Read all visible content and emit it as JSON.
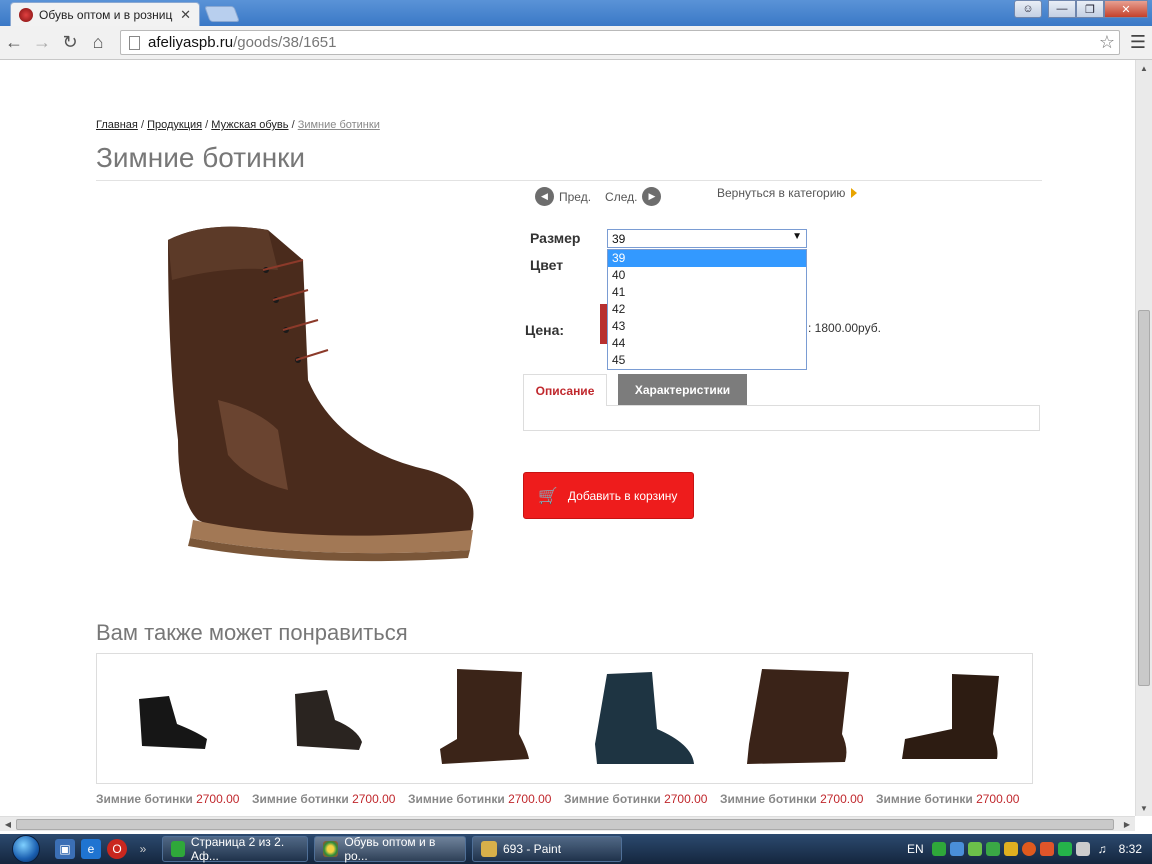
{
  "browser": {
    "tab_title": "Обувь оптом и в розниц",
    "tab_close": "✕",
    "url_host": "afeliyaspb.ru",
    "url_path": "/goods/38/1651"
  },
  "breadcrumb": {
    "home": "Главная",
    "sep": "/",
    "products": "Продукция",
    "mens": "Мужская обувь",
    "current": "Зимние ботинки"
  },
  "product": {
    "title": "Зимние ботинки",
    "prev_label": "Пред.",
    "next_label": "След.",
    "back_label": "Вернуться в категорию",
    "size_label": "Размер",
    "color_label": "Цвет",
    "price_label": "Цена:",
    "price_text": ": 1800.00руб.",
    "selected_size": "39",
    "size_options": [
      "39",
      "40",
      "41",
      "42",
      "43",
      "44",
      "45"
    ],
    "tab_description": "Описание",
    "tab_characteristics": "Характеристики",
    "cart_button": "Добавить в корзину"
  },
  "also": {
    "title": "Вам также может понравиться",
    "items": [
      {
        "name": "Зимние ботинки",
        "price": "2700.00"
      },
      {
        "name": "Зимние ботинки",
        "price": "2700.00"
      },
      {
        "name": "Зимние ботинки",
        "price": "2700.00"
      },
      {
        "name": "Зимние ботинки",
        "price": "2700.00"
      },
      {
        "name": "Зимние ботинки",
        "price": "2700.00"
      },
      {
        "name": "Зимние ботинки",
        "price": "2700.00"
      }
    ]
  },
  "taskbar": {
    "tasks": [
      {
        "label": "Страница 2 из 2. Аф..."
      },
      {
        "label": "Обувь оптом и в ро..."
      },
      {
        "label": "693 - Paint"
      }
    ],
    "lang": "EN",
    "time": "8:32"
  },
  "colors": {
    "accent_red": "#ee1c1c",
    "tab_active_red": "#c0282d",
    "select_highlight": "#3399ff"
  }
}
